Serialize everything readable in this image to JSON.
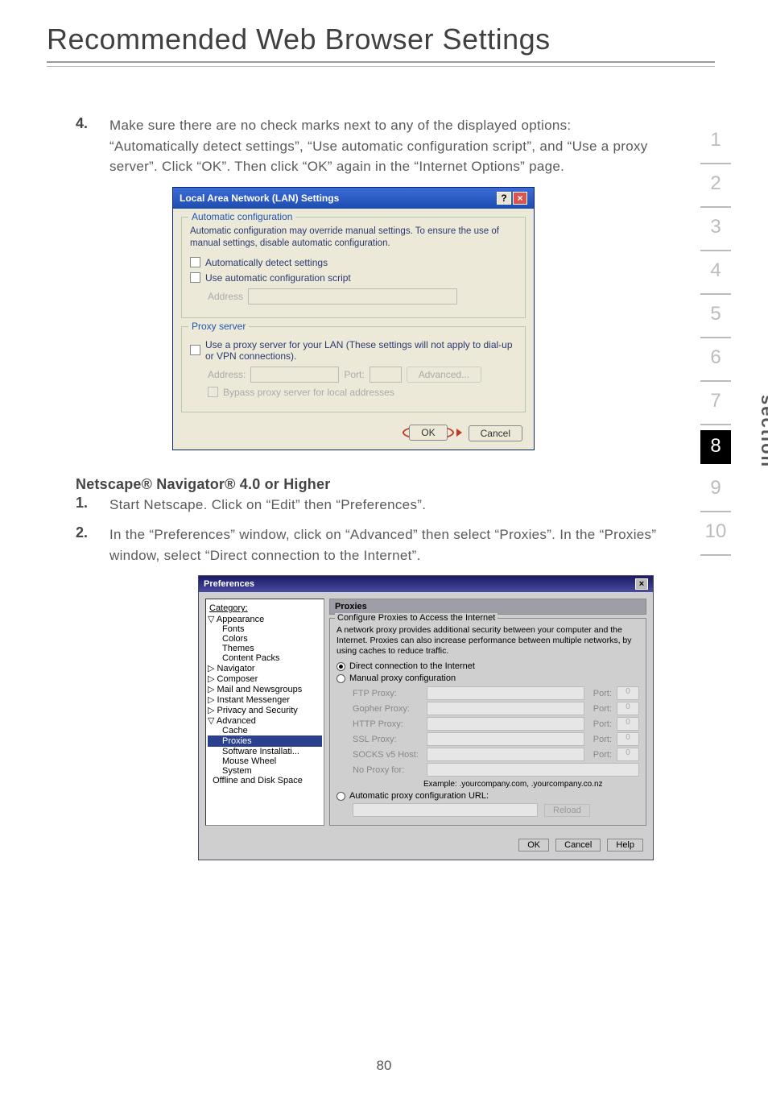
{
  "page": {
    "title": "Recommended Web Browser Settings",
    "number": "80"
  },
  "sidebar": {
    "label": "section",
    "items": [
      "1",
      "2",
      "3",
      "4",
      "5",
      "6",
      "7",
      "8",
      "9",
      "10"
    ],
    "active_index": 7
  },
  "step4": {
    "num": "4.",
    "text": "Make sure there are no check marks next to any of the displayed options: “Automatically detect settings”, “Use automatic configuration script”, and “Use a proxy server”. Click “OK”. Then click “OK” again in the “Internet Options” page."
  },
  "lan_dialog": {
    "title": "Local Area Network (LAN) Settings",
    "help": "?",
    "close": "×",
    "auto_legend": "Automatic configuration",
    "auto_desc": "Automatic configuration may override manual settings.  To ensure the use of manual settings, disable automatic configuration.",
    "auto_detect": "Automatically detect settings",
    "auto_script": "Use automatic configuration script",
    "address_label": "Address",
    "proxy_legend": "Proxy server",
    "proxy_use": "Use a proxy server for your LAN (These settings will not apply to dial-up or VPN connections).",
    "proxy_address": "Address:",
    "proxy_port": "Port:",
    "advanced": "Advanced...",
    "bypass": "Bypass proxy server for local addresses",
    "ok": "OK",
    "cancel": "Cancel"
  },
  "netscape_heading": "Netscape® Navigator® 4.0 or Higher",
  "step1": {
    "num": "1.",
    "text": "Start Netscape. Click on “Edit” then “Preferences”."
  },
  "step2": {
    "num": "2.",
    "text": "In the “Preferences” window, click on “Advanced” then select “Proxies”. In the “Proxies” window, select “Direct connection to the Internet”."
  },
  "ns_dialog": {
    "title": "Preferences",
    "close": "×",
    "category": "Category:",
    "tree": {
      "appearance": "Appearance",
      "fonts": "Fonts",
      "colors": "Colors",
      "themes": "Themes",
      "content_packs": "Content Packs",
      "navigator": "Navigator",
      "composer": "Composer",
      "mail_news": "Mail and Newsgroups",
      "instant_messenger": "Instant Messenger",
      "privacy": "Privacy and Security",
      "advanced": "Advanced",
      "cache": "Cache",
      "proxies": "Proxies",
      "software": "Software Installati...",
      "mouse": "Mouse Wheel",
      "system": "System",
      "offline": "Offline and Disk Space"
    },
    "panel_title": "Proxies",
    "fieldset_legend": "Configure Proxies to Access the Internet",
    "desc": "A network proxy provides additional security between your computer and the Internet. Proxies can also increase performance between multiple networks, by using caches to reduce traffic.",
    "direct": "Direct connection to the Internet",
    "manual": "Manual proxy configuration",
    "ftp": "FTP Proxy:",
    "gopher": "Gopher Proxy:",
    "http": "HTTP Proxy:",
    "ssl": "SSL Proxy:",
    "socks": "SOCKS v5 Host:",
    "noproxy": "No Proxy for:",
    "port": "Port:",
    "port_val": "0",
    "example": "Example:  .yourcompany.com, .yourcompany.co.nz",
    "auto_url": "Automatic proxy configuration URL:",
    "reload": "Reload",
    "ok": "OK",
    "cancel": "Cancel",
    "help": "Help"
  }
}
